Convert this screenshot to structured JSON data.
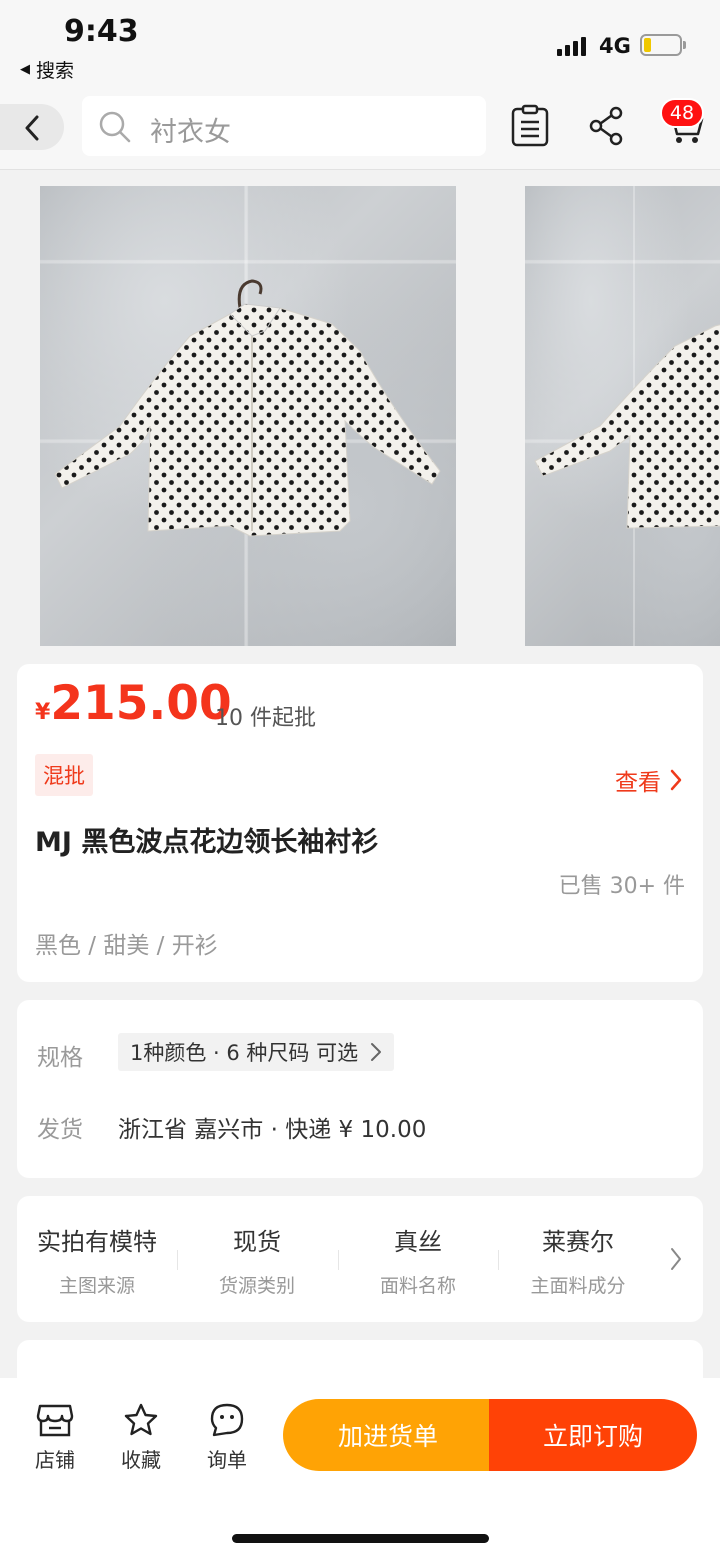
{
  "status_bar": {
    "time": "9:43",
    "back_app": "搜索",
    "network": "4G"
  },
  "nav": {
    "search_placeholder": "衬衣女",
    "cart_count": "48"
  },
  "product": {
    "currency": "¥",
    "price": "215.00",
    "moq": "10 件起批",
    "tag": "混批",
    "view_label": "查看",
    "title": "MJ 黑色波点花边领长袖衬衫",
    "sold": "已售 30+ 件",
    "attrs": "黑色 / 甜美 / 开衫"
  },
  "spec": {
    "label": "规格",
    "value": "1种颜色 · 6 种尺码  可选",
    "ship_label": "发货",
    "ship_value": "浙江省 嘉兴市   ·   快递  ¥ 10.00"
  },
  "features": [
    {
      "value": "实拍有模特",
      "key": "主图来源"
    },
    {
      "value": "现货",
      "key": "货源类别"
    },
    {
      "value": "真丝",
      "key": "面料名称"
    },
    {
      "value": "莱赛尔",
      "key": "主面料成分"
    }
  ],
  "bottom_bar": {
    "tabs": [
      {
        "label": "店铺"
      },
      {
        "label": "收藏"
      },
      {
        "label": "询单"
      }
    ],
    "add_to_list": "加进货单",
    "buy_now": "立即订购"
  },
  "colors": {
    "accent": "#f4341c",
    "orange": "#ffa305",
    "red_orange": "#ff4206"
  },
  "icons": [
    "chevron-left-icon",
    "search-icon",
    "list-icon",
    "share-icon",
    "cart-icon",
    "store-icon",
    "star-icon",
    "chat-icon",
    "chevron-right-icon"
  ]
}
